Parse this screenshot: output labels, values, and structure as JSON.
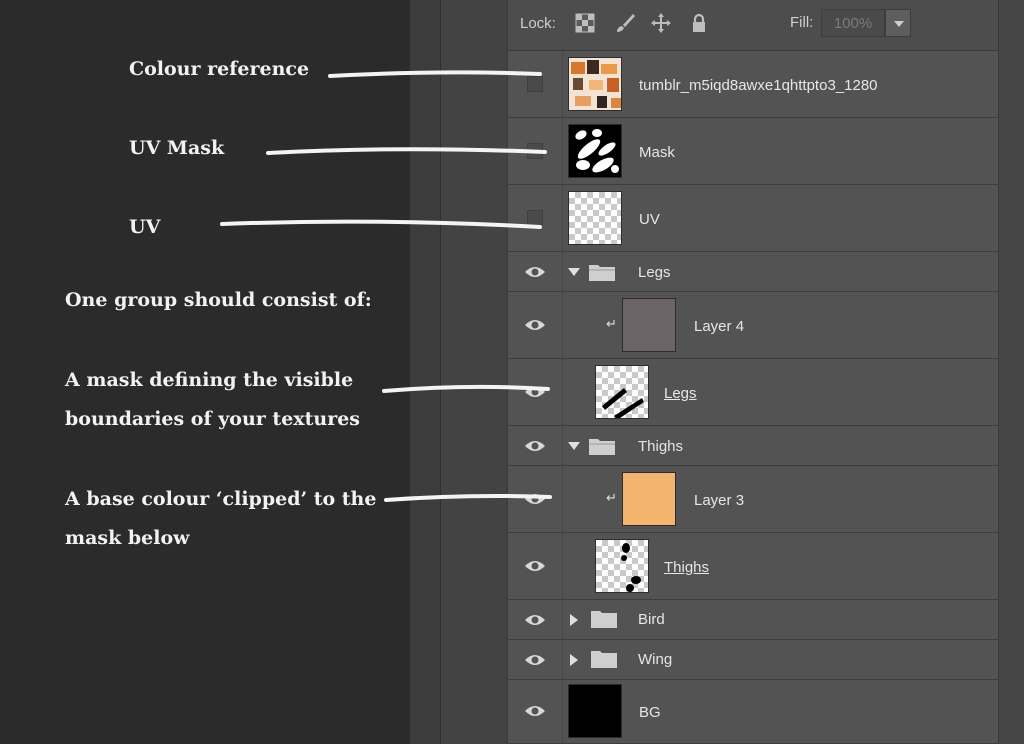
{
  "annotations": {
    "colour_reference": "Colour reference",
    "uv_mask": "UV Mask",
    "uv": "UV",
    "group_heading": "One group should consist of:",
    "mask_line1": "A mask defining the visible",
    "mask_line2": "boundaries of your textures",
    "base_line1": "A base colour ‘clipped’ to the",
    "base_line2": "mask below"
  },
  "toolbar": {
    "lock_label": "Lock:",
    "fill_label": "Fill:",
    "fill_value": "100%",
    "icons": [
      "lock-transparent-pixels-icon",
      "lock-image-pixels-icon",
      "lock-position-icon",
      "lock-all-icon"
    ]
  },
  "layers": [
    {
      "name": "tumblr_m5iqd8awxe1qhttpto3_1280",
      "visible": false,
      "thumbnail": "colour-photo"
    },
    {
      "name": "Mask",
      "visible": false,
      "thumbnail": "mask"
    },
    {
      "name": "UV",
      "visible": false,
      "thumbnail": "transparent"
    },
    {
      "name": "Legs",
      "visible": true,
      "type": "group",
      "expanded": true
    },
    {
      "name": "Layer 4",
      "visible": true,
      "clipped": true,
      "thumbnail_color": "#6b6366"
    },
    {
      "name": "Legs",
      "visible": true,
      "thumbnail": "legs-mask"
    },
    {
      "name": "Thighs",
      "visible": true,
      "type": "group",
      "expanded": true
    },
    {
      "name": "Layer 3",
      "visible": true,
      "clipped": true,
      "thumbnail_color": "#f5b46e"
    },
    {
      "name": "Thighs",
      "visible": true,
      "thumbnail": "thighs-mask"
    },
    {
      "name": "Bird",
      "visible": true,
      "type": "group",
      "expanded": false
    },
    {
      "name": "Wing",
      "visible": true,
      "type": "group",
      "expanded": false
    },
    {
      "name": "BG",
      "visible": true,
      "thumbnail_color": "#000000"
    }
  ]
}
